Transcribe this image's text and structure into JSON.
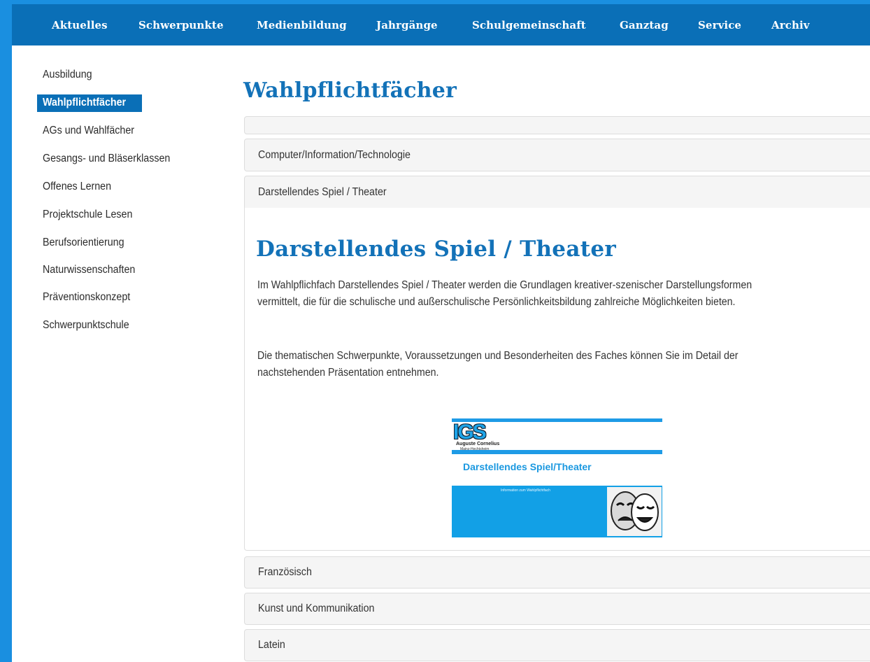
{
  "nav": {
    "items": [
      "Aktuelles",
      "Schwerpunkte",
      "Medienbildung",
      "Jahrgänge",
      "Schulgemeinschaft",
      "Ganztag",
      "Service",
      "Archiv"
    ]
  },
  "sidebar": {
    "items": [
      {
        "label": "Ausbildung"
      },
      {
        "label": "Wahlpflichtfächer",
        "active": true
      },
      {
        "label": "AGs und Wahlfächer"
      },
      {
        "label": "Gesangs- und Bläserklassen"
      },
      {
        "label": "Offenes Lernen"
      },
      {
        "label": "Projektschule Lesen"
      },
      {
        "label": "Berufsorientierung"
      },
      {
        "label": "Naturwissenschaften"
      },
      {
        "label": "Präventionskonzept"
      },
      {
        "label": "Schwerpunktschule"
      }
    ]
  },
  "page": {
    "title": "Wahlpflichtfächer"
  },
  "accordion": {
    "panels": [
      {
        "label": ""
      },
      {
        "label": "Computer/Information/Technologie"
      },
      {
        "label": "Darstellendes Spiel / Theater",
        "expanded": true
      },
      {
        "label": "Französisch"
      },
      {
        "label": "Kunst und Kommunikation"
      },
      {
        "label": "Latein"
      }
    ]
  },
  "content": {
    "title": "Darstellendes Spiel / Theater",
    "para1_line1": "Im Wahlpflichfach Darstellendes Spiel / Theater werden die Grundlagen kreativer-szenischer Darstellungsformen",
    "para1_line2": "vermittelt, die für die schulische und außerschulische Persönlichkeitsbildung zahlreiche Möglichkeiten bieten.",
    "para2_line1": "Die thematischen Schwerpunkte, Voraussetzungen und Besonderheiten des Faches können Sie im Detail der",
    "para2_line2": "nachstehenden Präsentation entnehmen."
  },
  "presentation_thumb": {
    "logo": "IGS",
    "logo_sub": "Auguste Cornelius",
    "logo_sub2": "Mainz-Hechtsheim",
    "title": "Darstellendes Spiel/Theater",
    "subtitle": "Information zum Wahlpflichtfach"
  },
  "colors": {
    "nav_bg": "#0a6fb7",
    "accent": "#1a8fe0",
    "heading": "#1372b8"
  }
}
